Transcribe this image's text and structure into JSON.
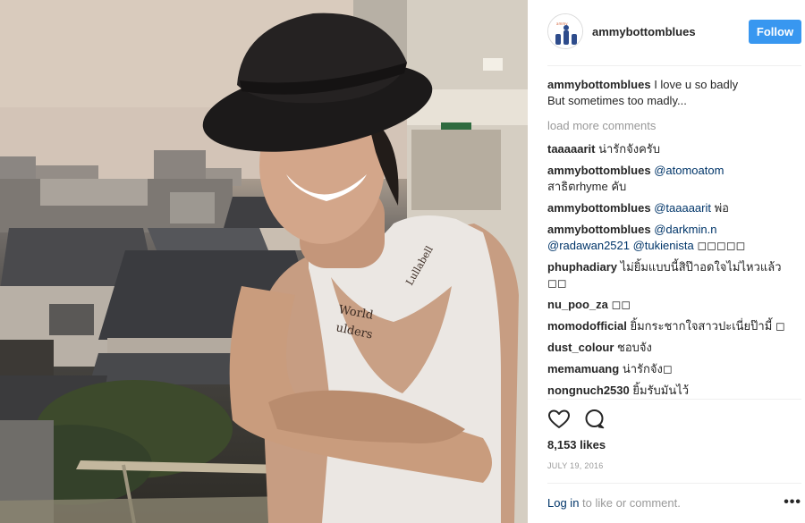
{
  "post": {
    "username": "ammybottomblues",
    "follow_label": "Follow",
    "avatar_icon": "avatar-illustration-icon",
    "photo_description_icon": "post-photo",
    "caption": {
      "user": "ammybottomblues",
      "text": " I love u so badly\nBut sometimes too madly..."
    },
    "load_more": "load more comments",
    "comments": [
      {
        "user": "taaaaarit",
        "text": " น่ารักจังครับ"
      },
      {
        "user": "ammybottomblues",
        "mention": " @atomoatom",
        "text": "\nสาธิตrhyme คับ"
      },
      {
        "user": "ammybottomblues",
        "mention": " @taaaaarit",
        "text": " พ่อ"
      },
      {
        "user": "ammybottomblues",
        "mention": " @darkmin.n\n@radawan2521 @tukienista",
        "text": " ◻◻◻◻◻"
      },
      {
        "user": "phuphadiary",
        "text": " ไม่ยิ้มแบบนี้สิป๊าอดใจไม่ไหวแล้ว ◻◻"
      },
      {
        "user": "nu_poo_za",
        "text": " ◻◻"
      },
      {
        "user": "momodofficial",
        "text": " ยิ้มกระชากใจสาวปะเนี่ยป๊ามี้ ◻"
      },
      {
        "user": "dust_colour",
        "text": " ชอบจัง"
      },
      {
        "user": "memamuang",
        "text": " น่ารักจัง◻"
      },
      {
        "user": "nongnuch2530",
        "text": " ยิ้มรับมันไว้"
      }
    ],
    "likes": "8,153 likes",
    "date": "JULY 19, 2016",
    "footer": {
      "login": "Log in",
      "suffix": " to like or comment.",
      "more": "•••"
    },
    "colors": {
      "follow_bg": "#3897f0",
      "mention": "#003569",
      "muted": "#999999"
    },
    "icons": {
      "like": "heart-outline-icon",
      "comment": "speech-bubble-icon",
      "more": "more-options-icon"
    }
  }
}
